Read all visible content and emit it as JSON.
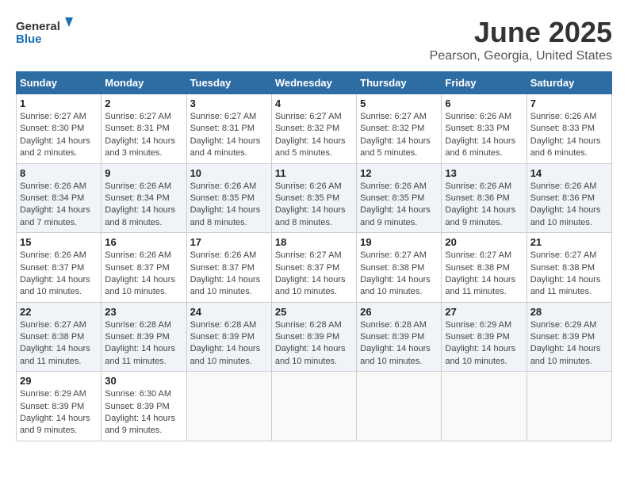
{
  "header": {
    "logo_general": "General",
    "logo_blue": "Blue",
    "month_title": "June 2025",
    "location": "Pearson, Georgia, United States"
  },
  "days_of_week": [
    "Sunday",
    "Monday",
    "Tuesday",
    "Wednesday",
    "Thursday",
    "Friday",
    "Saturday"
  ],
  "weeks": [
    [
      {
        "day": "1",
        "sunrise": "6:27 AM",
        "sunset": "8:30 PM",
        "daylight": "14 hours and 2 minutes."
      },
      {
        "day": "2",
        "sunrise": "6:27 AM",
        "sunset": "8:31 PM",
        "daylight": "14 hours and 3 minutes."
      },
      {
        "day": "3",
        "sunrise": "6:27 AM",
        "sunset": "8:31 PM",
        "daylight": "14 hours and 4 minutes."
      },
      {
        "day": "4",
        "sunrise": "6:27 AM",
        "sunset": "8:32 PM",
        "daylight": "14 hours and 5 minutes."
      },
      {
        "day": "5",
        "sunrise": "6:27 AM",
        "sunset": "8:32 PM",
        "daylight": "14 hours and 5 minutes."
      },
      {
        "day": "6",
        "sunrise": "6:26 AM",
        "sunset": "8:33 PM",
        "daylight": "14 hours and 6 minutes."
      },
      {
        "day": "7",
        "sunrise": "6:26 AM",
        "sunset": "8:33 PM",
        "daylight": "14 hours and 6 minutes."
      }
    ],
    [
      {
        "day": "8",
        "sunrise": "6:26 AM",
        "sunset": "8:34 PM",
        "daylight": "14 hours and 7 minutes."
      },
      {
        "day": "9",
        "sunrise": "6:26 AM",
        "sunset": "8:34 PM",
        "daylight": "14 hours and 8 minutes."
      },
      {
        "day": "10",
        "sunrise": "6:26 AM",
        "sunset": "8:35 PM",
        "daylight": "14 hours and 8 minutes."
      },
      {
        "day": "11",
        "sunrise": "6:26 AM",
        "sunset": "8:35 PM",
        "daylight": "14 hours and 8 minutes."
      },
      {
        "day": "12",
        "sunrise": "6:26 AM",
        "sunset": "8:35 PM",
        "daylight": "14 hours and 9 minutes."
      },
      {
        "day": "13",
        "sunrise": "6:26 AM",
        "sunset": "8:36 PM",
        "daylight": "14 hours and 9 minutes."
      },
      {
        "day": "14",
        "sunrise": "6:26 AM",
        "sunset": "8:36 PM",
        "daylight": "14 hours and 10 minutes."
      }
    ],
    [
      {
        "day": "15",
        "sunrise": "6:26 AM",
        "sunset": "8:37 PM",
        "daylight": "14 hours and 10 minutes."
      },
      {
        "day": "16",
        "sunrise": "6:26 AM",
        "sunset": "8:37 PM",
        "daylight": "14 hours and 10 minutes."
      },
      {
        "day": "17",
        "sunrise": "6:26 AM",
        "sunset": "8:37 PM",
        "daylight": "14 hours and 10 minutes."
      },
      {
        "day": "18",
        "sunrise": "6:27 AM",
        "sunset": "8:37 PM",
        "daylight": "14 hours and 10 minutes."
      },
      {
        "day": "19",
        "sunrise": "6:27 AM",
        "sunset": "8:38 PM",
        "daylight": "14 hours and 10 minutes."
      },
      {
        "day": "20",
        "sunrise": "6:27 AM",
        "sunset": "8:38 PM",
        "daylight": "14 hours and 11 minutes."
      },
      {
        "day": "21",
        "sunrise": "6:27 AM",
        "sunset": "8:38 PM",
        "daylight": "14 hours and 11 minutes."
      }
    ],
    [
      {
        "day": "22",
        "sunrise": "6:27 AM",
        "sunset": "8:38 PM",
        "daylight": "14 hours and 11 minutes."
      },
      {
        "day": "23",
        "sunrise": "6:28 AM",
        "sunset": "8:39 PM",
        "daylight": "14 hours and 11 minutes."
      },
      {
        "day": "24",
        "sunrise": "6:28 AM",
        "sunset": "8:39 PM",
        "daylight": "14 hours and 10 minutes."
      },
      {
        "day": "25",
        "sunrise": "6:28 AM",
        "sunset": "8:39 PM",
        "daylight": "14 hours and 10 minutes."
      },
      {
        "day": "26",
        "sunrise": "6:28 AM",
        "sunset": "8:39 PM",
        "daylight": "14 hours and 10 minutes."
      },
      {
        "day": "27",
        "sunrise": "6:29 AM",
        "sunset": "8:39 PM",
        "daylight": "14 hours and 10 minutes."
      },
      {
        "day": "28",
        "sunrise": "6:29 AM",
        "sunset": "8:39 PM",
        "daylight": "14 hours and 10 minutes."
      }
    ],
    [
      {
        "day": "29",
        "sunrise": "6:29 AM",
        "sunset": "8:39 PM",
        "daylight": "14 hours and 9 minutes."
      },
      {
        "day": "30",
        "sunrise": "6:30 AM",
        "sunset": "8:39 PM",
        "daylight": "14 hours and 9 minutes."
      },
      null,
      null,
      null,
      null,
      null
    ]
  ],
  "labels": {
    "sunrise": "Sunrise: ",
    "sunset": "Sunset: ",
    "daylight": "Daylight: "
  }
}
